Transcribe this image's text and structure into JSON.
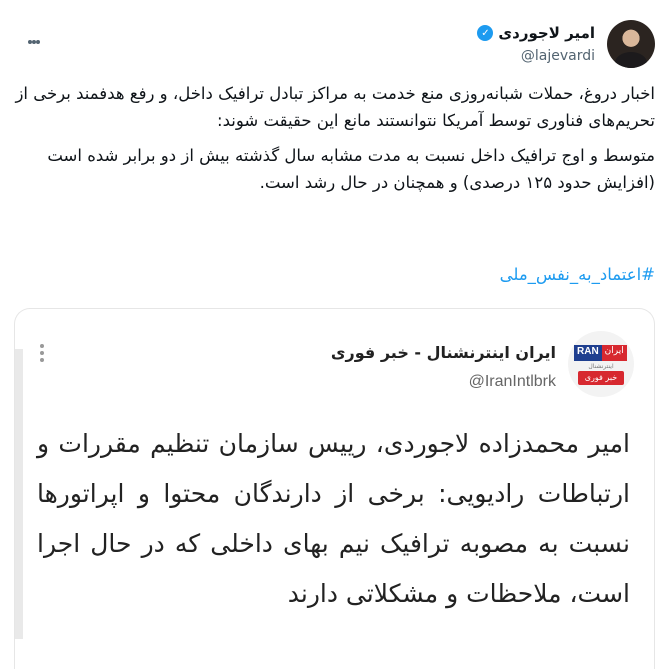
{
  "author": {
    "name": "امیر لاجوردی",
    "handle": "@lajevardi",
    "verified_icon": "verified-badge-icon",
    "verified_glyph": "✓"
  },
  "tweet": {
    "paragraph_1": "اخبار دروغ، حملات شبانه‌روزی منع خدمت به مراکز تبادل ترافیک داخل، و رفع هدفمند برخی از تحریم‌های فناوری توسط آمریکا نتوانستند مانع این حقیقت شوند:",
    "paragraph_2": "متوسط و اوج ترافیک داخل نسبت به مدت مشابه سال گذشته بیش از  دو برابر شده است (افزایش حدود ۱۲۵ درصدی) و همچنان در حال رشد است.",
    "hashtag": "#اعتماد_به_نفس_ملی"
  },
  "embed": {
    "name": "ایران اینترنشنال - خبر فوری",
    "handle": "@IranIntlbrk",
    "logo": {
      "ran": "RAN",
      "fa": "ایران",
      "sub": "اینترنشنال",
      "bottom": "خبر فوری"
    },
    "text": "امیر محمدزاده لاجوردی، رییس سازمان تنظیم مقررات و ارتباطات رادیویی: برخی از دارندگان محتوا و اپراتورها نسبت به مصوبه ترافیک نیم بهای داخلی که در حال اجرا است، ملاحظات و مشکلاتی دارند"
  },
  "colors": {
    "link": "#1d9bf0",
    "secondary_text": "#536471",
    "primary_text": "#0f1419"
  }
}
